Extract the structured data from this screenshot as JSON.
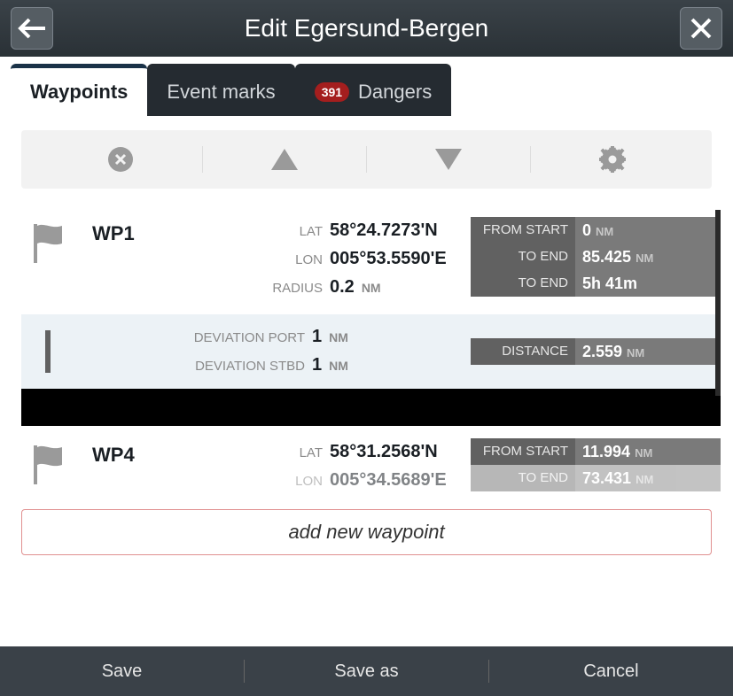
{
  "header": {
    "title": "Edit Egersund-Bergen"
  },
  "tabs": {
    "waypoints": "Waypoints",
    "event_marks": "Event marks",
    "dangers_label": "Dangers",
    "dangers_count": "391"
  },
  "waypoints": [
    {
      "name": "WP1",
      "lat_label": "LAT",
      "lat": "58°24.7273'N",
      "lon_label": "LON",
      "lon": "005°53.5590'E",
      "radius_label": "RADIUS",
      "radius_val": "0.2",
      "radius_unit": "NM",
      "stats": [
        {
          "label": "FROM START",
          "value": "0",
          "unit": "NM"
        },
        {
          "label": "TO END",
          "value": "85.425",
          "unit": "NM"
        },
        {
          "label": "TO END",
          "value": "5h 41m",
          "unit": ""
        }
      ]
    },
    {
      "name": "WP4",
      "lat_label": "LAT",
      "lat": "58°31.2568'N",
      "lon_label": "LON",
      "lon": "005°34.5689'E",
      "stats": [
        {
          "label": "FROM START",
          "value": "11.994",
          "unit": "NM"
        },
        {
          "label": "TO END",
          "value": "73.431",
          "unit": "NM"
        }
      ]
    }
  ],
  "leg": {
    "dev_port_label": "DEVIATION PORT",
    "dev_port_val": "1",
    "dev_port_unit": "NM",
    "dev_stbd_label": "DEVIATION STBD",
    "dev_stbd_val": "1",
    "dev_stbd_unit": "NM",
    "distance_label": "DISTANCE",
    "distance_val": "2.559",
    "distance_unit": "NM"
  },
  "add_waypoint": "add new waypoint",
  "footer": {
    "save": "Save",
    "save_as": "Save as",
    "cancel": "Cancel"
  }
}
